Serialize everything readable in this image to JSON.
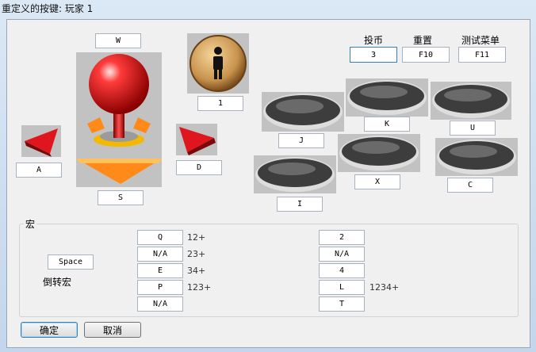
{
  "window": {
    "title": "重定义的按键: 玩家 1"
  },
  "joystick": {
    "up": "W",
    "down": "S",
    "left": "A",
    "right": "D",
    "player": "1"
  },
  "top": {
    "coin_label": "投币",
    "coin_value": "3",
    "reset_label": "重置",
    "reset_value": "F10",
    "test_label": "测试菜单",
    "test_value": "F11"
  },
  "buttons": {
    "b1": "J",
    "b2": "K",
    "b3": "U",
    "b4": "I",
    "b5": "X",
    "b6": "C"
  },
  "macro": {
    "group_label": "宏",
    "space": "Space",
    "reverse_label": "倒转宏",
    "left": [
      {
        "key": "Q",
        "combo": "12+"
      },
      {
        "key": "N/A",
        "combo": "23+"
      },
      {
        "key": "E",
        "combo": "34+"
      },
      {
        "key": "P",
        "combo": "123+"
      },
      {
        "key": "N/A",
        "combo": ""
      }
    ],
    "right": [
      {
        "key": "2",
        "combo": ""
      },
      {
        "key": "N/A",
        "combo": ""
      },
      {
        "key": "4",
        "combo": ""
      },
      {
        "key": "L",
        "combo": "1234+"
      },
      {
        "key": "T",
        "combo": ""
      }
    ]
  },
  "footer": {
    "ok": "确定",
    "cancel": "取消"
  },
  "colors": {
    "ball": "#e0161e",
    "wood": "#c8934d",
    "button_face": "#4a4a4a",
    "tile": "#c2c2c2"
  }
}
